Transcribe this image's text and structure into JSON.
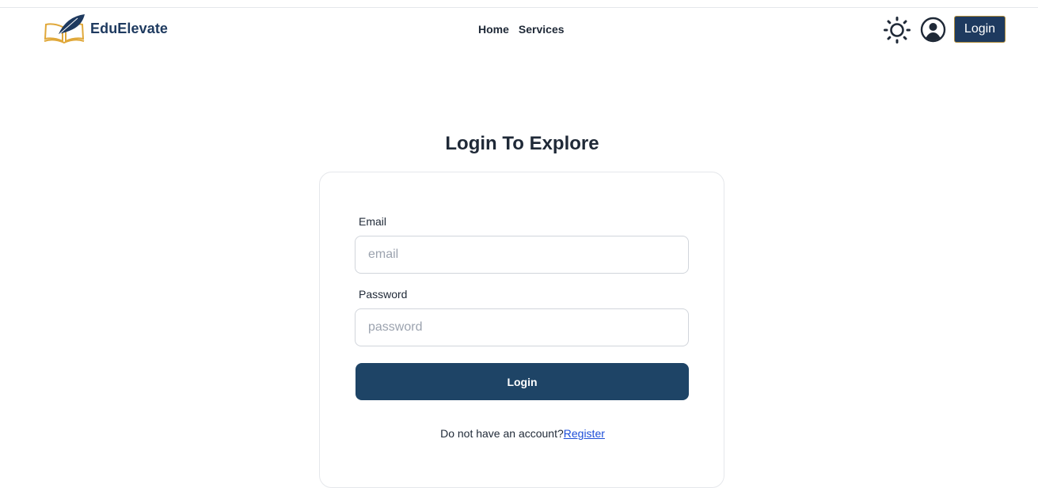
{
  "navbar": {
    "brand_name": "EduElevate",
    "links": [
      {
        "label": "Home"
      },
      {
        "label": "Services"
      }
    ],
    "login_label": "Login",
    "icons": {
      "theme": "sun-icon",
      "profile": "user-circle-icon",
      "logo": "book-quill-logo"
    }
  },
  "page": {
    "title": "Login To Explore"
  },
  "form": {
    "email_label": "Email",
    "email_placeholder": "email",
    "email_value": "",
    "password_label": "Password",
    "password_placeholder": "password",
    "password_value": "",
    "submit_label": "Login",
    "register_prompt": "Do not have an account?",
    "register_link": "Register"
  },
  "colors": {
    "primary": "#1e3a5f",
    "button": "#1e4466",
    "accent": "#b08d3c",
    "link": "#1d4ed8"
  }
}
